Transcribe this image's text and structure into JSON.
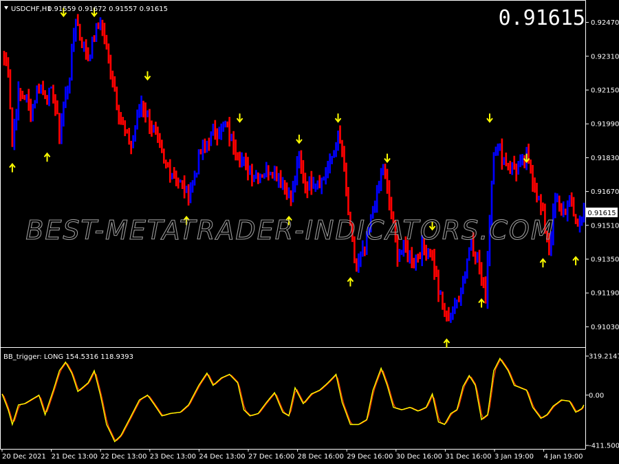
{
  "header": {
    "symbol_label": "USDCHF,H1",
    "ohlc_label": "0.91559 0.91672 0.91557 0.91615",
    "big_price": "0.91615",
    "current_price_tag": "0.91615"
  },
  "watermark": "BEST-METATRADER-INDICATORS.COM",
  "indicator": {
    "label": "BB_trigger: LONG 154.5316 118.9393",
    "ticks": [
      "319.2147",
      "0.00",
      "-411.5004"
    ]
  },
  "colors": {
    "background": "#000000",
    "bull_bar": "#0000ff",
    "bear_bar": "#ff0000",
    "arrow": "#ffff00",
    "line_fast": "#ffff00",
    "line_slow": "#ff4000",
    "axis": "#ffffff"
  },
  "chart_data": [
    {
      "type": "bar",
      "symbol": "USDCHF",
      "timeframe": "H1",
      "ylim": [
        0.9095,
        0.9255
      ],
      "y_ticks": [
        "0.92470",
        "0.92310",
        "0.92150",
        "0.91990",
        "0.91830",
        "0.91670",
        "0.91510",
        "0.91350",
        "0.91190",
        "0.91030"
      ],
      "x_ticks": [
        "20 Dec 2021",
        "21 Dec 13:00",
        "22 Dec 13:00",
        "23 Dec 13:00",
        "24 Dec 13:00",
        "27 Dec 16:00",
        "28 Dec 16:00",
        "29 Dec 16:00",
        "30 Dec 16:00",
        "31 Dec 16:00",
        "3 Jan 19:00",
        "4 Jan 19:00"
      ],
      "x_domain": [
        0,
        284
      ],
      "close_path": [
        [
          0,
          0.9232
        ],
        [
          3,
          0.9226
        ],
        [
          5,
          0.919
        ],
        [
          8,
          0.9213
        ],
        [
          11,
          0.9212
        ],
        [
          14,
          0.9205
        ],
        [
          18,
          0.9218
        ],
        [
          21,
          0.9213
        ],
        [
          25,
          0.9213
        ],
        [
          28,
          0.9195
        ],
        [
          33,
          0.9223
        ],
        [
          36,
          0.925
        ],
        [
          38,
          0.924
        ],
        [
          42,
          0.923
        ],
        [
          45,
          0.924
        ],
        [
          48,
          0.9248
        ],
        [
          53,
          0.9225
        ],
        [
          58,
          0.92
        ],
        [
          63,
          0.9188
        ],
        [
          68,
          0.921
        ],
        [
          73,
          0.9198
        ],
        [
          79,
          0.918
        ],
        [
          85,
          0.9174
        ],
        [
          91,
          0.9165
        ],
        [
          97,
          0.9185
        ],
        [
          103,
          0.9195
        ],
        [
          109,
          0.9198
        ],
        [
          114,
          0.9188
        ],
        [
          119,
          0.9178
        ],
        [
          125,
          0.9175
        ],
        [
          131,
          0.9178
        ],
        [
          137,
          0.9172
        ],
        [
          141,
          0.9163
        ],
        [
          145,
          0.9182
        ],
        [
          148,
          0.917
        ],
        [
          152,
          0.9173
        ],
        [
          156,
          0.9172
        ],
        [
          160,
          0.918
        ],
        [
          164,
          0.9193
        ],
        [
          166,
          0.9185
        ],
        [
          170,
          0.9148
        ],
        [
          173,
          0.913
        ],
        [
          177,
          0.914
        ],
        [
          181,
          0.9158
        ],
        [
          186,
          0.9178
        ],
        [
          190,
          0.9155
        ],
        [
          193,
          0.9138
        ],
        [
          197,
          0.914
        ],
        [
          201,
          0.9135
        ],
        [
          205,
          0.914
        ],
        [
          209,
          0.914
        ],
        [
          213,
          0.912
        ],
        [
          217,
          0.9107
        ],
        [
          221,
          0.9112
        ],
        [
          225,
          0.9125
        ],
        [
          229,
          0.9145
        ],
        [
          233,
          0.913
        ],
        [
          236,
          0.9117
        ],
        [
          238,
          0.9155
        ],
        [
          240,
          0.9188
        ],
        [
          243,
          0.9186
        ],
        [
          247,
          0.918
        ],
        [
          251,
          0.9177
        ],
        [
          256,
          0.9183
        ],
        [
          260,
          0.917
        ],
        [
          264,
          0.9155
        ],
        [
          267,
          0.914
        ],
        [
          270,
          0.9162
        ],
        [
          274,
          0.9158
        ],
        [
          278,
          0.916
        ],
        [
          281,
          0.915
        ],
        [
          284,
          0.91615
        ]
      ],
      "down_arrows": [
        [
          30,
          0.925
        ],
        [
          45,
          0.925
        ],
        [
          71,
          0.922
        ],
        [
          116,
          0.92
        ],
        [
          145,
          0.919
        ],
        [
          164,
          0.92
        ],
        [
          188,
          0.9181
        ],
        [
          210,
          0.9149
        ],
        [
          238,
          0.92
        ],
        [
          256,
          0.9181
        ]
      ],
      "up_arrows": [
        [
          5,
          0.918
        ],
        [
          22,
          0.9185
        ],
        [
          90,
          0.9155
        ],
        [
          140,
          0.9155
        ],
        [
          170,
          0.9126
        ],
        [
          217,
          0.9097
        ],
        [
          234,
          0.9116
        ],
        [
          264,
          0.9135
        ],
        [
          280,
          0.9136
        ]
      ]
    },
    {
      "type": "line",
      "name": "BB_trigger",
      "ylim": [
        -411.5004,
        319.2147
      ],
      "x_domain": [
        0,
        284
      ],
      "series": [
        {
          "values": [
            [
              0,
              10
            ],
            [
              3,
              -120
            ],
            [
              5,
              -240
            ],
            [
              8,
              -80
            ],
            [
              11,
              -70
            ],
            [
              14,
              -40
            ],
            [
              18,
              0
            ],
            [
              21,
              -160
            ],
            [
              25,
              40
            ],
            [
              28,
              200
            ],
            [
              31,
              270
            ],
            [
              34,
              180
            ],
            [
              37,
              30
            ],
            [
              42,
              100
            ],
            [
              45,
              200
            ],
            [
              48,
              0
            ],
            [
              51,
              -240
            ],
            [
              55,
              -380
            ],
            [
              58,
              -330
            ],
            [
              63,
              -170
            ],
            [
              67,
              -40
            ],
            [
              71,
              0
            ],
            [
              74,
              -70
            ],
            [
              78,
              -170
            ],
            [
              82,
              -150
            ],
            [
              87,
              -140
            ],
            [
              91,
              -80
            ],
            [
              96,
              80
            ],
            [
              100,
              180
            ],
            [
              103,
              80
            ],
            [
              107,
              140
            ],
            [
              111,
              170
            ],
            [
              115,
              100
            ],
            [
              118,
              -120
            ],
            [
              121,
              -170
            ],
            [
              125,
              -150
            ],
            [
              129,
              -60
            ],
            [
              133,
              20
            ],
            [
              137,
              -140
            ],
            [
              140,
              -170
            ],
            [
              143,
              60
            ],
            [
              147,
              -70
            ],
            [
              151,
              10
            ],
            [
              155,
              40
            ],
            [
              159,
              100
            ],
            [
              163,
              170
            ],
            [
              166,
              -60
            ],
            [
              170,
              -240
            ],
            [
              174,
              -240
            ],
            [
              178,
              -200
            ],
            [
              181,
              40
            ],
            [
              185,
              220
            ],
            [
              188,
              80
            ],
            [
              191,
              -100
            ],
            [
              195,
              -120
            ],
            [
              199,
              -100
            ],
            [
              203,
              -130
            ],
            [
              207,
              -100
            ],
            [
              210,
              10
            ],
            [
              213,
              -220
            ],
            [
              216,
              -240
            ],
            [
              219,
              -150
            ],
            [
              222,
              -120
            ],
            [
              225,
              70
            ],
            [
              228,
              160
            ],
            [
              231,
              80
            ],
            [
              234,
              -200
            ],
            [
              237,
              -160
            ],
            [
              240,
              200
            ],
            [
              243,
              300
            ],
            [
              247,
              200
            ],
            [
              250,
              80
            ],
            [
              253,
              60
            ],
            [
              256,
              40
            ],
            [
              259,
              -100
            ],
            [
              263,
              -190
            ],
            [
              266,
              -160
            ],
            [
              269,
              -90
            ],
            [
              273,
              -40
            ],
            [
              277,
              -50
            ],
            [
              280,
              -140
            ],
            [
              283,
              -110
            ],
            [
              284,
              -80
            ]
          ]
        }
      ]
    }
  ]
}
